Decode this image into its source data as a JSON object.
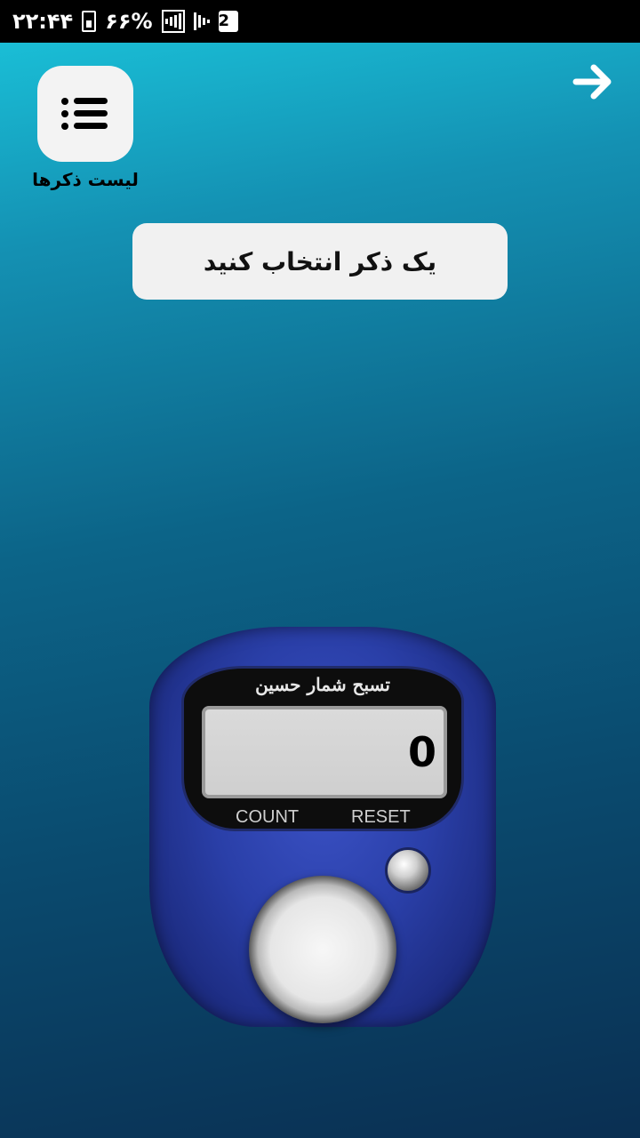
{
  "status_bar": {
    "time": "۲۲:۴۴",
    "battery_percent": "۶۶%",
    "sim_number": "2"
  },
  "menu": {
    "label": "لیست ذکرها",
    "icon": "list-icon"
  },
  "back": {
    "icon": "arrow-right-icon"
  },
  "prompt": {
    "text": "یک ذکر انتخاب کنید"
  },
  "counter": {
    "title": "تسبح شمار حسین",
    "value": "0",
    "count_label": "COUNT",
    "reset_label": "RESET"
  },
  "colors": {
    "background_top": "#1bc7dd",
    "background_bottom": "#0a2f52",
    "device_blue": "#2a3fa8"
  }
}
